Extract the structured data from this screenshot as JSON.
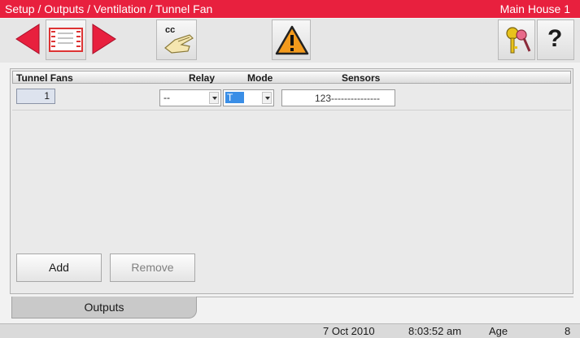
{
  "titlebar": {
    "breadcrumb": "Setup / Outputs / Ventilation / Tunnel Fan",
    "house": "Main House 1"
  },
  "toolbar": {
    "cc_label": "cc",
    "help_label": "?"
  },
  "table": {
    "headers": {
      "name": "Tunnel Fans",
      "relay": "Relay",
      "mode": "Mode",
      "sensors": "Sensors"
    },
    "rows": [
      {
        "index": "1",
        "relay": "--",
        "mode": "T",
        "sensors": "123---------------"
      }
    ]
  },
  "buttons": {
    "add": "Add",
    "remove": "Remove"
  },
  "tabs": [
    {
      "label": "Outputs"
    }
  ],
  "status": {
    "date": "7 Oct 2010",
    "time": "8:03:52 am",
    "age_label": "Age",
    "age_value": "8"
  },
  "colors": {
    "titlebar": "#e8203e",
    "nav_arrow": "#e8203e",
    "warning": "#f39a1c",
    "selection": "#3a8ee6"
  },
  "icons": {
    "back": "left-arrow-icon",
    "menu": "menu-card-icon",
    "forward": "right-arrow-icon",
    "cc": "hand-cc-icon",
    "warning": "warning-icon",
    "keys": "keys-icon",
    "help": "help-icon"
  }
}
